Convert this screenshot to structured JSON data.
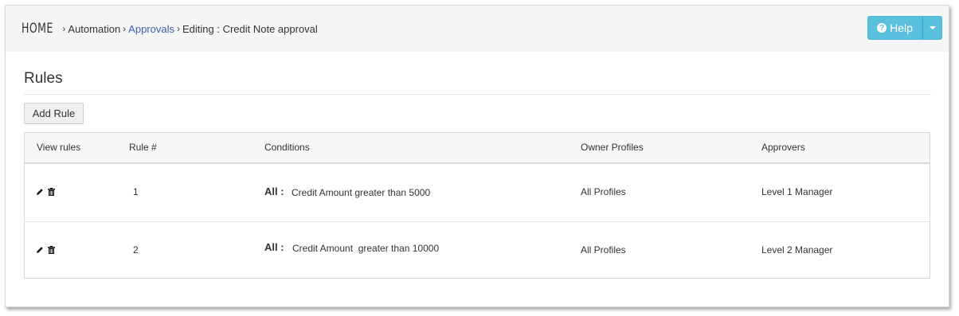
{
  "breadcrumb": {
    "home": "HOME",
    "automation": "Automation",
    "approvals": "Approvals",
    "current": "Editing : Credit Note approval"
  },
  "help": {
    "label": "Help"
  },
  "section": {
    "title": "Rules"
  },
  "add_rule_label": "Add Rule",
  "table": {
    "headers": [
      "View rules",
      "Rule #",
      "Conditions",
      "Owner Profiles",
      "Approvers"
    ],
    "rows": [
      {
        "rule": "1",
        "cond_scope": "All :",
        "condition": "Credit Amount greater than 5000",
        "owner": "All Profiles",
        "approver": "Level 1 Manager"
      },
      {
        "rule": "2",
        "cond_scope": "All :",
        "condition": "Credit Amount  greater than 10000",
        "owner": "All Profiles",
        "approver": "Level 2 Manager"
      }
    ]
  },
  "icons": {
    "edit": "pencil-icon",
    "delete": "trash-icon",
    "help": "question-circle-icon",
    "dropdown": "caret-down-icon"
  },
  "colors": {
    "help_button": "#5bc0de",
    "link": "#3a62b0"
  }
}
